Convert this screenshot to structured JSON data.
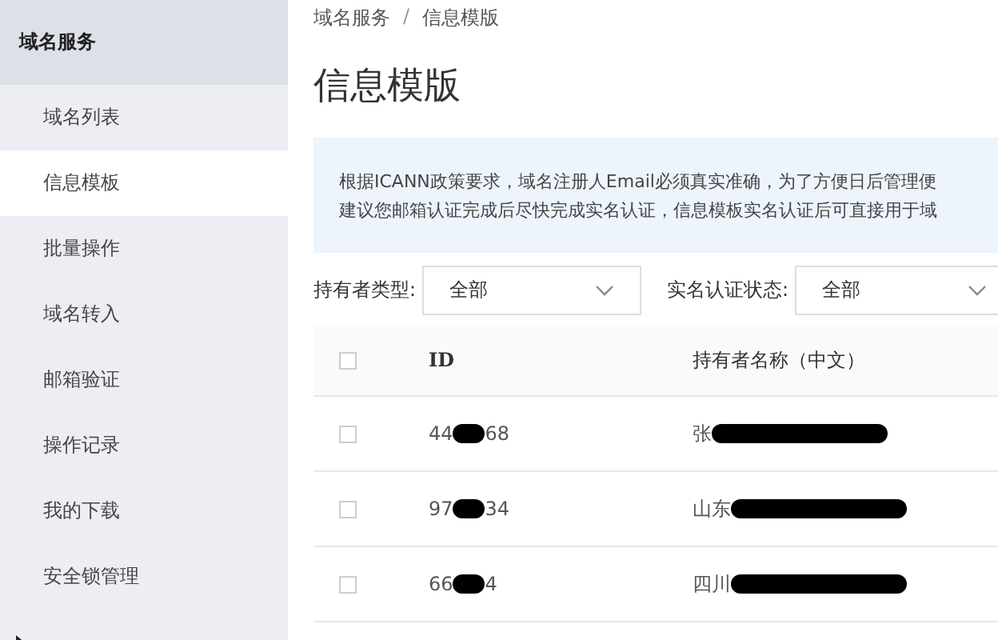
{
  "sidebar": {
    "title": "域名服务",
    "items": [
      {
        "label": "域名列表",
        "selected": false,
        "expandable": false
      },
      {
        "label": "信息模板",
        "selected": true,
        "expandable": false
      },
      {
        "label": "批量操作",
        "selected": false,
        "expandable": false
      },
      {
        "label": "域名转入",
        "selected": false,
        "expandable": false
      },
      {
        "label": "邮箱验证",
        "selected": false,
        "expandable": false
      },
      {
        "label": "操作记录",
        "selected": false,
        "expandable": false
      },
      {
        "label": "我的下载",
        "selected": false,
        "expandable": false
      },
      {
        "label": "安全锁管理",
        "selected": false,
        "expandable": false
      },
      {
        "selected": false,
        "expandable": true
      }
    ]
  },
  "breadcrumb": [
    "域名服务",
    "信息模版"
  ],
  "breadcrumb_separator": "/",
  "page_title": "信息模版",
  "notice": [
    "根据ICANN政策要求，域名注册人Email必须真实准确，为了方便日后管理便",
    "建议您邮箱认证完成后尽快完成实名认证，信息模板实名认证后可直接用于域"
  ],
  "filters": [
    {
      "label": "持有者类型:",
      "value": "全部"
    },
    {
      "label": "实名认证状态:",
      "value": "全部"
    }
  ],
  "table": {
    "select_all_checked": false,
    "columns": [
      "ID",
      "持有者名称（中文）"
    ],
    "rows": [
      {
        "checked": false,
        "id": [
          "44",
          "68"
        ],
        "name": "张"
      },
      {
        "checked": false,
        "id": [
          "97",
          "34"
        ],
        "name": "山东"
      },
      {
        "checked": false,
        "id": [
          "66",
          "4"
        ],
        "name": "四川"
      }
    ]
  }
}
